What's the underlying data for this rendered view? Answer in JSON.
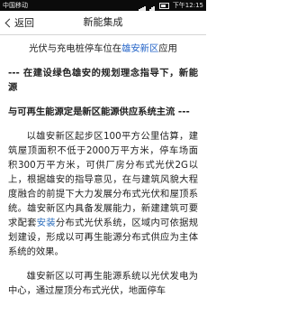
{
  "status_bar": {
    "carrier": "中国移动",
    "time": "下午12:15"
  },
  "header": {
    "back_label": "返回",
    "title": "新能集成"
  },
  "article": {
    "lead": {
      "before": "光伏与充电桩停车位在",
      "link": "雄安新区",
      "after": "应用"
    },
    "heading_1": "--- 在建设绿色雄安的规划理念指导下，新能源",
    "heading_2": "与可再生能源定是新区能源供应系统主流 ---",
    "para_1": {
      "before": "以雄安新区起步区100平方公里估算，建筑屋顶面积不低于2000万平方米，停车场面积300万平方米，可供厂房分布式光伏2G以上，根据雄安的指导意见，在与建筑风貌大程度融合的前提下大力发展分布式光伏和屋顶系统。雄安新区内具备发展能力，新建建筑可要求配套",
      "link": "安装",
      "after": "分布式光伏系统，区域内可依据规划建设，形成以可再生能源分布式供应为主体系统的效果。"
    },
    "para_2": "雄安新区以可再生能源系统以光伏发电为中心，通过屋顶分布式光伏，地面停车"
  }
}
